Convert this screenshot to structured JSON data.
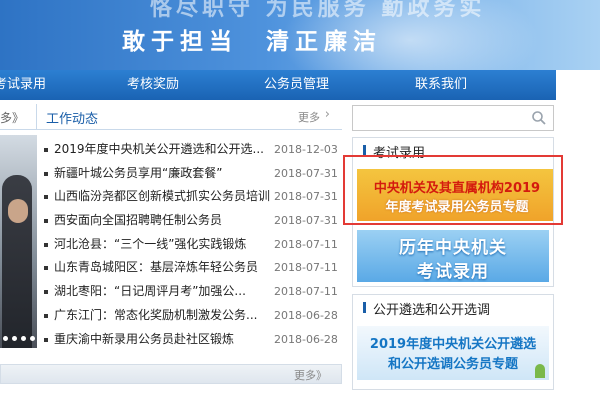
{
  "banner": {
    "slogan_top": "恪尽职守 为民服务 勤政务实",
    "slogan_left": "敢于担当",
    "slogan_right": "清正廉洁"
  },
  "nav": {
    "items": [
      "考试录用",
      "考核奖励",
      "公务员管理",
      "联系我们"
    ]
  },
  "news": {
    "prev_more": "多》",
    "title": "工作动态",
    "more": "更多",
    "items": [
      {
        "title": "2019年度中央机关公开遴选和公开选...",
        "date": "2018-12-03"
      },
      {
        "title": "新疆叶城公务员享用“廉政套餐”",
        "date": "2018-07-31"
      },
      {
        "title": "山西临汾尧都区创新模式抓实公务员培训",
        "date": "2018-07-31"
      },
      {
        "title": "西安面向全国招聘聘任制公务员",
        "date": "2018-07-31"
      },
      {
        "title": "河北沧县：“三个一线”强化实践锻炼",
        "date": "2018-07-11"
      },
      {
        "title": "山东青岛城阳区：基层淬炼年轻公务员",
        "date": "2018-07-11"
      },
      {
        "title": "湖北枣阳：“日记周评月考”加强公...",
        "date": "2018-07-11"
      },
      {
        "title": "广东江门：常态化奖励机制激发公务...",
        "date": "2018-06-28"
      },
      {
        "title": "重庆渝中新录用公务员赴社区锻炼",
        "date": "2018-06-28"
      }
    ],
    "footer_more": "更多》"
  },
  "search": {
    "placeholder": ""
  },
  "sidebar": {
    "exam_title": "考试录用",
    "promo1_line1": "中央机关及其直属机构2019",
    "promo1_line2": "年度考试录用公务员专题",
    "promo2_line1": "历年中央机关",
    "promo2_line2": "考试录用",
    "select_title": "公开遴选和公开选调",
    "promo3_line1": "2019年度中央机关公开遴选",
    "promo3_line2": "和公开选调公务员专题"
  },
  "colors": {
    "nav_blue": "#1a63b3",
    "title_blue": "#1a5ea8",
    "highlight_red": "#e33a35"
  }
}
